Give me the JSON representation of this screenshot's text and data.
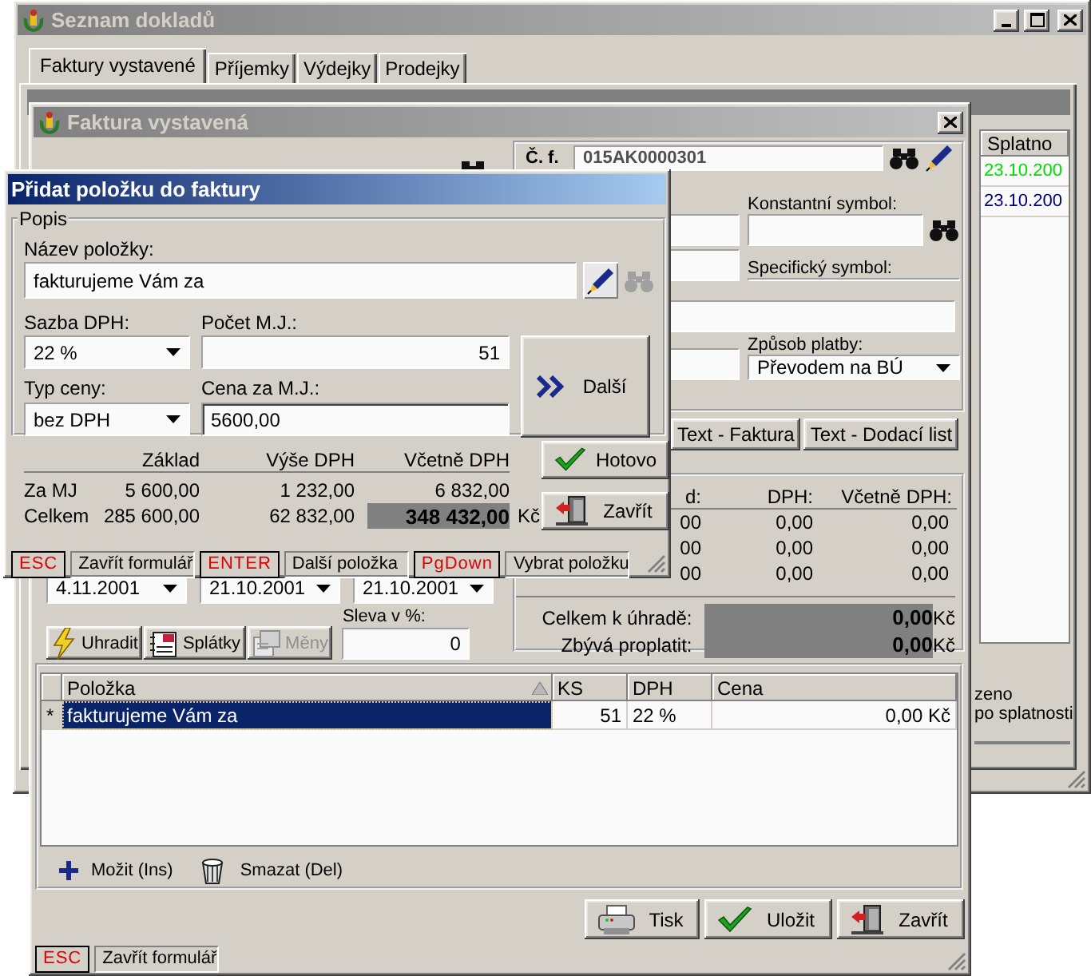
{
  "list_window": {
    "title": "Seznam dokladů",
    "active": false,
    "tabs": [
      {
        "label": "Faktury vystavené",
        "selected": true
      },
      {
        "label": "Příjemky",
        "selected": false
      },
      {
        "label": "Výdejky",
        "selected": false
      },
      {
        "label": "Prodejky",
        "selected": false
      }
    ],
    "table": {
      "column": "Splatno",
      "rows": [
        {
          "value": "23.10.200",
          "color": "#00e000"
        },
        {
          "value": "23.10.200",
          "color": "#000080"
        }
      ]
    },
    "legend": [
      "zeno",
      "po splatnosti"
    ]
  },
  "invoice_window": {
    "title": "Faktura vystavená",
    "active": false,
    "number": {
      "label": "Č. f.",
      "value": "015AK0000301"
    },
    "constant_symbol_label": "Konstantní symbol:",
    "specific_symbol_label": "Specifický symbol:",
    "payment_method": {
      "label": "Způsob platby:",
      "value": "Převodem na BÚ"
    },
    "text_buttons": [
      "Text - Faktura",
      "Text - Dodací list"
    ],
    "totals": {
      "columns": [
        "d:",
        "DPH:",
        "Včetně DPH:"
      ],
      "rows": [
        [
          "00",
          "0,00",
          "0,00"
        ],
        [
          "00",
          "0,00",
          "0,00"
        ],
        [
          "00",
          "0,00",
          "0,00"
        ]
      ],
      "summary": [
        {
          "label": "Celkem k úhradě:",
          "value": "0,00",
          "currency": "Kč"
        },
        {
          "label": "Zbývá proplatit:",
          "value": "0,00",
          "currency": "Kč"
        }
      ]
    },
    "dates": [
      "4.11.2001",
      "21.10.2001",
      "21.10.2001"
    ],
    "discount": {
      "label": "Sleva v %:",
      "value": "0"
    },
    "actions": [
      {
        "kind": "pay",
        "label": "Uhradit",
        "disabled": false
      },
      {
        "kind": "installments",
        "label": "Splátky",
        "disabled": false
      },
      {
        "kind": "currency",
        "label": "Měny",
        "disabled": true
      }
    ],
    "items": {
      "columns": [
        "Položka",
        "KS",
        "DPH",
        "Cena"
      ],
      "rows": [
        {
          "marker": "*",
          "name": "fakturujeme Vám za",
          "quantity": "51",
          "vat": "22 %",
          "price": "0,00 Kč",
          "selected": true
        }
      ]
    },
    "item_actions": [
      {
        "kind": "add",
        "label": "Možit (Ins)"
      },
      {
        "kind": "delete",
        "label": "Smazat (Del)"
      }
    ],
    "buttons": [
      {
        "kind": "print",
        "label": "Tisk"
      },
      {
        "kind": "save",
        "label": "Uložit"
      },
      {
        "kind": "close",
        "label": "Zavřít"
      }
    ],
    "shortcuts": [
      {
        "key": "ESC",
        "action": "Zavřít formulář"
      }
    ]
  },
  "add_item_dialog": {
    "title": "Přidat položku do faktury",
    "active": true,
    "group": "Popis",
    "name": {
      "label": "Název položky:",
      "value": "fakturujeme Vám za"
    },
    "vat_rate": {
      "label": "Sazba DPH:",
      "value": "22 %"
    },
    "quantity": {
      "label": "Počet M.J.:",
      "value": "51"
    },
    "price_type": {
      "label": "Typ ceny:",
      "value": "bez DPH"
    },
    "unit_price": {
      "label": "Cena za M.J.:",
      "value": "5600,00"
    },
    "next_button": "Další",
    "summary": {
      "columns": [
        "Základ",
        "Výše DPH",
        "Včetně DPH"
      ],
      "rows": [
        {
          "label": "Za MJ",
          "values": [
            "5 600,00",
            "1 232,00",
            "6 832,00"
          ]
        },
        {
          "label": "Celkem",
          "values": [
            "285 600,00",
            "62 832,00",
            "348 432,00"
          ],
          "currency": "Kč"
        }
      ]
    },
    "buttons": [
      {
        "kind": "done",
        "label": "Hotovo"
      },
      {
        "kind": "close",
        "label": "Zavřít"
      }
    ],
    "shortcuts": [
      {
        "key": "ESC",
        "action": "Zavřít formulář"
      },
      {
        "key": "ENTER",
        "action": "Další položka"
      },
      {
        "key": "PgDown",
        "action": "Vybrat položku"
      }
    ]
  }
}
